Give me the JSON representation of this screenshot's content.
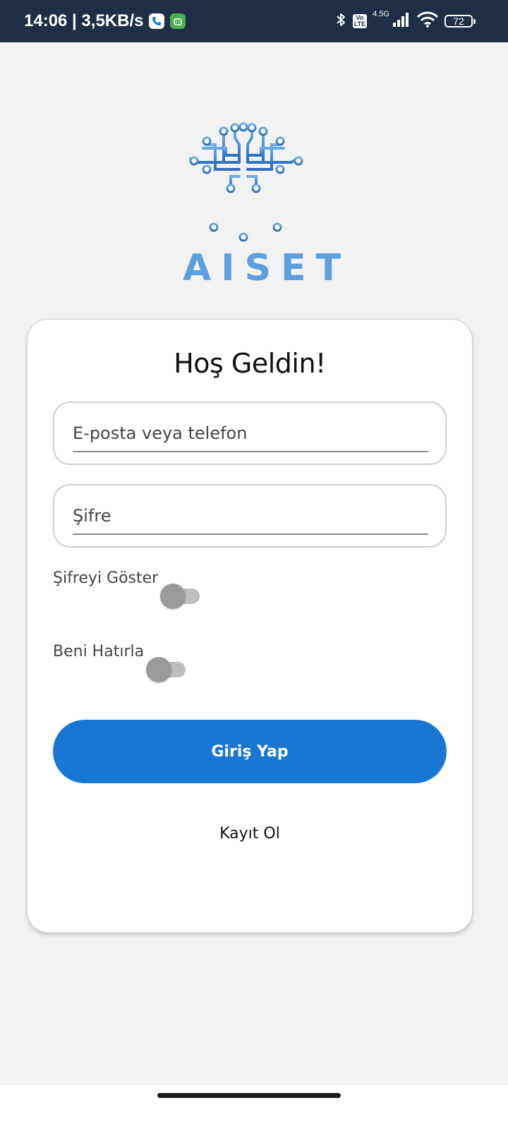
{
  "status_bar": {
    "time_speed": "14:06 | 3,5KB/s",
    "volte_label": "Vo\nLTE",
    "network_type": "4.5G",
    "battery_level": "72",
    "icons": [
      "phone-call-icon",
      "android-icon",
      "bluetooth-icon",
      "signal-icon",
      "wifi-icon",
      "battery-icon"
    ]
  },
  "logo": {
    "text": "AISET",
    "color": "#5b9fe0"
  },
  "login_card": {
    "title": "Hoş Geldin!",
    "email_placeholder": "E-posta veya telefon",
    "password_placeholder": "Şifre",
    "show_password_label": "Şifreyi Göster",
    "show_password_enabled": false,
    "remember_me_label": "Beni Hatırla",
    "remember_me_enabled": false,
    "login_button": "Giriş Yap",
    "register_link": "Kayıt Ol"
  },
  "colors": {
    "primary": "#1976d2",
    "status_bar_bg": "#1e2e46",
    "background": "#f2f2f2"
  }
}
